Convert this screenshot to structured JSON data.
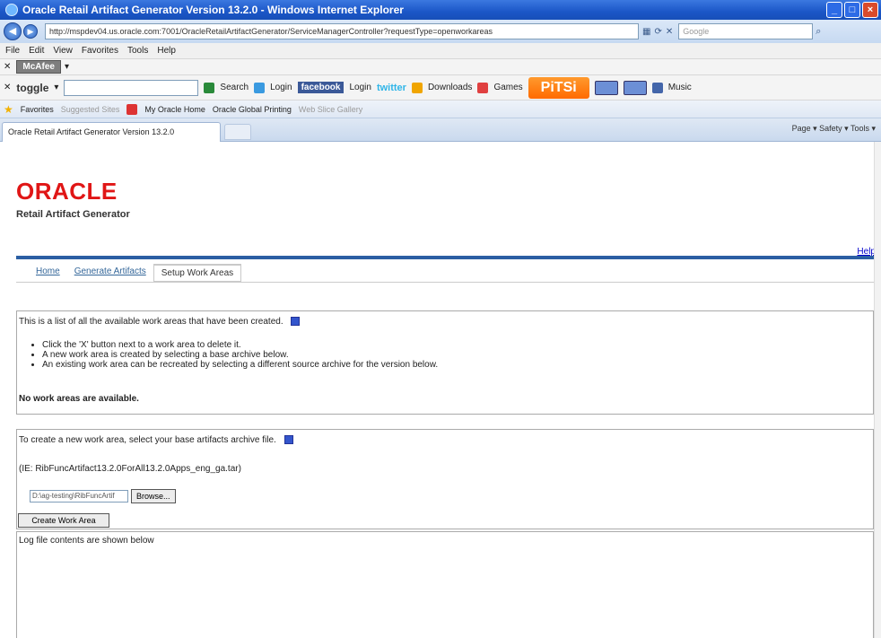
{
  "window": {
    "title": "Oracle Retail Artifact Generator Version 13.2.0 - Windows Internet Explorer"
  },
  "address_bar": {
    "url": "http://mspdev04.us.oracle.com:7001/OracleRetailArtifactGenerator/ServiceManagerController?requestType=openworkareas",
    "search_placeholder": "Google"
  },
  "menu": [
    "File",
    "Edit",
    "View",
    "Favorites",
    "Tools",
    "Help"
  ],
  "mcafee_bar": {
    "label": "McAfee"
  },
  "toolbar": {
    "toggle_label": "toggle",
    "search_label": "Search",
    "login1": "Login",
    "facebook": "facebook",
    "login2": "Login",
    "twitter": "twitter",
    "downloads": "Downloads",
    "games": "Games",
    "pitsi": "PiTSi",
    "music": "Music"
  },
  "favorites_bar": {
    "favorites": "Favorites",
    "suggested_sites": "Suggested Sites",
    "my_oracle_home": "My Oracle Home",
    "oracle_global_printing": "Oracle Global Printing",
    "web_slice_gallery": "Web Slice Gallery"
  },
  "tab": {
    "title": "Oracle Retail Artifact Generator Version 13.2.0"
  },
  "command_bar": "Page ▾  Safety ▾  Tools ▾",
  "page": {
    "logo": "ORACLE",
    "product": "Retail Artifact Generator",
    "help": "Help",
    "nav": [
      "Home",
      "Generate Artifacts",
      "Setup Work Areas"
    ],
    "intro": "This is a list of all the available work areas that have been created.",
    "bullets": [
      "Click the 'X' button next to a work area to delete it.",
      "A new work area is created by selecting a base archive below.",
      "An existing work area can be recreated by selecting a different source archive for the version below."
    ],
    "no_work_areas": "No work areas are available.",
    "create_intro": "To create a new work area, select your base artifacts archive file.",
    "ie_example": "(IE:  RibFuncArtifact13.2.0ForAll13.2.0Apps_eng_ga.tar)",
    "file_value": "D:\\ag-testing\\RibFuncArtif",
    "browse_label": "Browse...",
    "create_button": "Create Work Area",
    "log_label": "Log file contents are shown below"
  }
}
